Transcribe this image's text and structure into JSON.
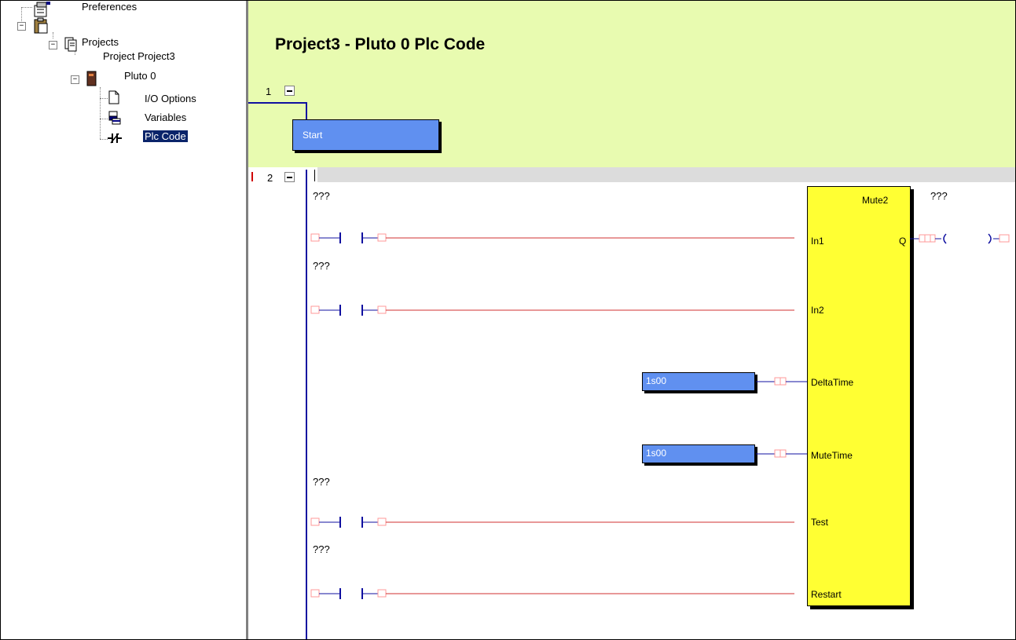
{
  "tree": {
    "items": [
      {
        "label": "Preferences"
      },
      {
        "label": "Projects"
      },
      {
        "label": "Project Project3"
      },
      {
        "label": "Pluto 0"
      },
      {
        "label": "I/O Options"
      },
      {
        "label": "Variables"
      },
      {
        "label": "Plc Code"
      }
    ]
  },
  "code": {
    "title": "Project3 - Pluto 0 Plc Code",
    "rung1": {
      "number": "1",
      "block_label": "Start"
    },
    "rung2": {
      "number": "2",
      "contact_labels": [
        "???",
        "???",
        "???",
        "???"
      ],
      "output_label": "???",
      "function_block": {
        "name": "Mute2",
        "inputs": [
          "In1",
          "In2",
          "DeltaTime",
          "MuteTime",
          "Test",
          "Restart"
        ],
        "output": "Q"
      },
      "constants": [
        "1s00",
        "1s00"
      ]
    }
  },
  "colors": {
    "header_bg": "#e8fbb0",
    "block_blue": "#6090f0",
    "function_block_yellow": "#ffff33",
    "rail": "#1010a0",
    "wire": "#d03030",
    "selection": "#0a246a"
  }
}
